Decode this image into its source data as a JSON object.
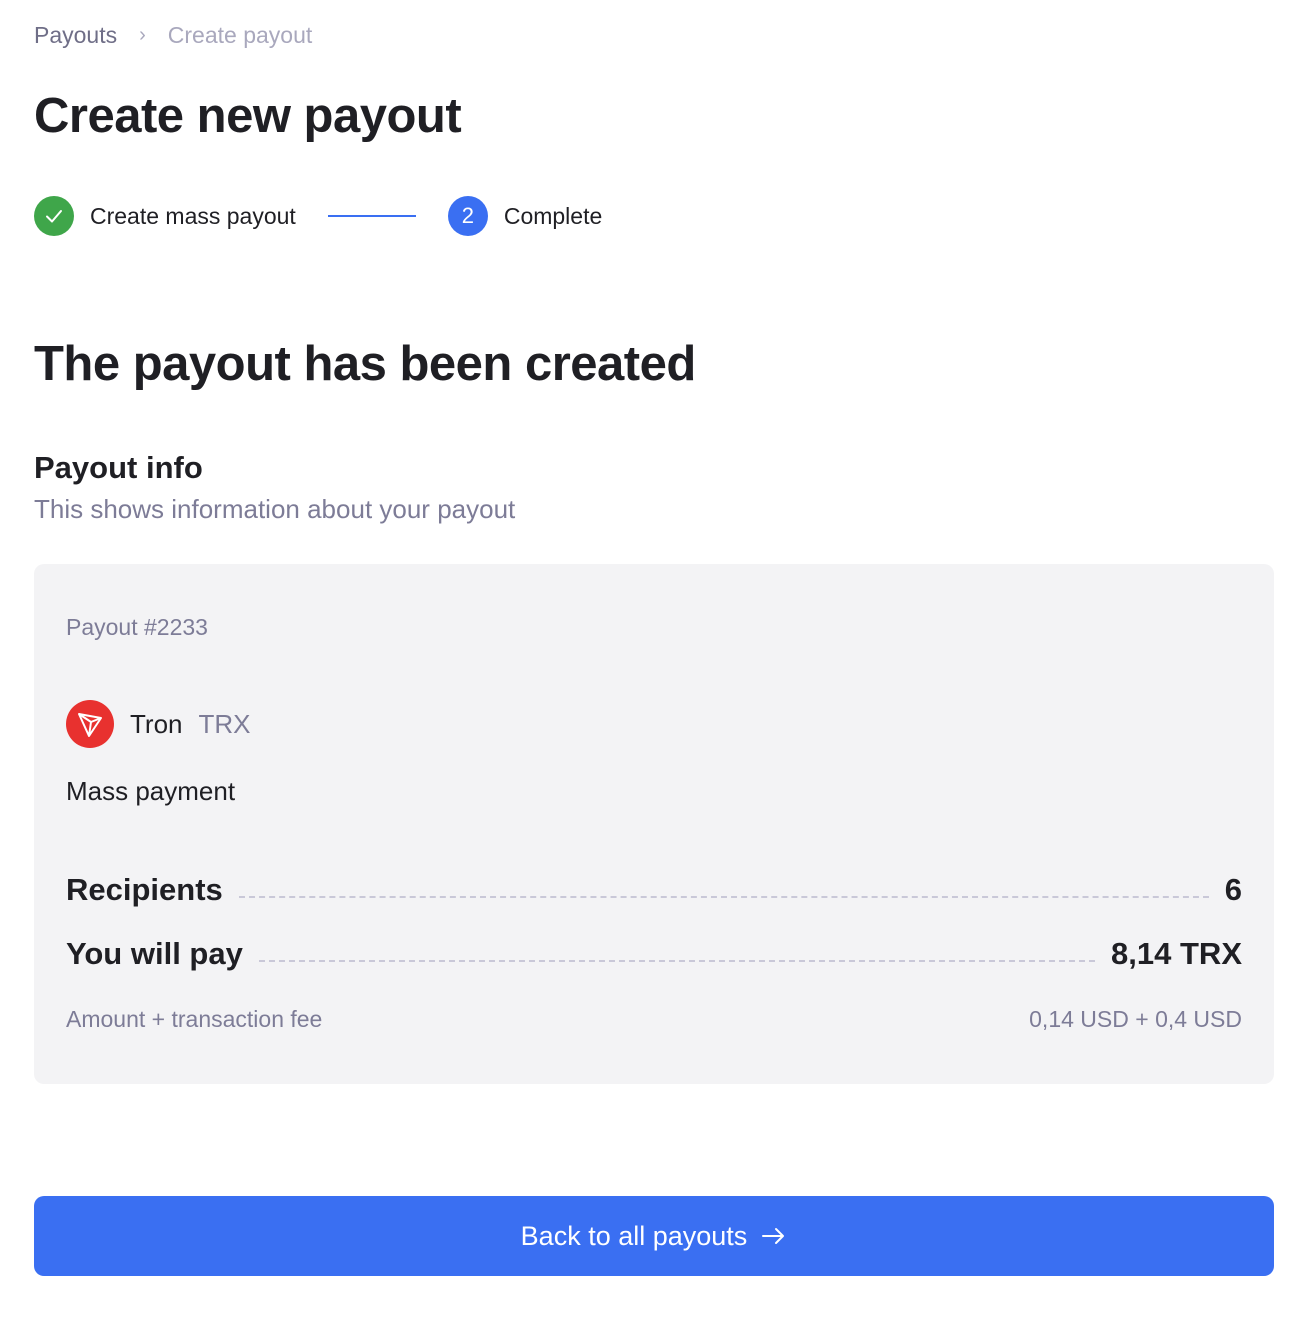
{
  "breadcrumb": {
    "parent": "Payouts",
    "separator": "›",
    "current": "Create payout"
  },
  "page_title": "Create new payout",
  "stepper": {
    "steps": [
      {
        "label": "Create mass payout",
        "status": "done"
      },
      {
        "label": "Complete",
        "number": "2",
        "status": "active"
      }
    ]
  },
  "success_title": "The payout has been created",
  "payout_info": {
    "title": "Payout info",
    "subtitle": "This shows information about your payout"
  },
  "card": {
    "payout_id": "Payout #2233",
    "coin_icon": "tron-icon",
    "coin_name": "Tron",
    "coin_ticker": "TRX",
    "payment_type": "Mass payment",
    "recipients_label": "Recipients",
    "recipients_value": "6",
    "pay_label": "You will pay",
    "pay_value": "8,14 TRX",
    "fee_label": "Amount + transaction fee",
    "fee_value": "0,14 USD + 0,4 USD"
  },
  "button": {
    "label": "Back to all payouts",
    "icon": "arrow-right-icon"
  },
  "colors": {
    "accent": "#3a6ff2",
    "success": "#3fa64a",
    "tron": "#e8312f"
  }
}
